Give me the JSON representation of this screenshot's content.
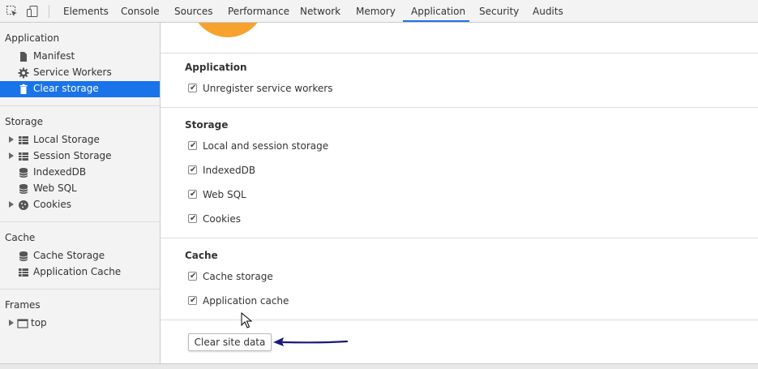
{
  "toolbar": {
    "tabs": [
      "Elements",
      "Console",
      "Sources",
      "Performance",
      "Network",
      "Memory",
      "Application",
      "Security",
      "Audits"
    ],
    "active_tab": "Application",
    "accent_color": "#1a73e8"
  },
  "sidebar": {
    "application": {
      "title": "Application",
      "items": [
        {
          "label": "Manifest",
          "icon": "file-icon"
        },
        {
          "label": "Service Workers",
          "icon": "gear-icon"
        },
        {
          "label": "Clear storage",
          "icon": "trash-icon",
          "selected": true
        }
      ]
    },
    "storage": {
      "title": "Storage",
      "items": [
        {
          "label": "Local Storage",
          "icon": "grid-icon",
          "expandable": true
        },
        {
          "label": "Session Storage",
          "icon": "grid-icon",
          "expandable": true
        },
        {
          "label": "IndexedDB",
          "icon": "database-icon"
        },
        {
          "label": "Web SQL",
          "icon": "database-icon"
        },
        {
          "label": "Cookies",
          "icon": "cookie-icon",
          "expandable": true
        }
      ]
    },
    "cache": {
      "title": "Cache",
      "items": [
        {
          "label": "Cache Storage",
          "icon": "database-icon"
        },
        {
          "label": "Application Cache",
          "icon": "grid-icon"
        }
      ]
    },
    "frames": {
      "title": "Frames",
      "items": [
        {
          "label": "top",
          "icon": "frame-icon",
          "expandable": true
        }
      ]
    }
  },
  "main": {
    "application_group": {
      "title": "Application",
      "options": [
        {
          "label": "Unregister service workers",
          "checked": true
        }
      ]
    },
    "storage_group": {
      "title": "Storage",
      "options": [
        {
          "label": "Local and session storage",
          "checked": true
        },
        {
          "label": "IndexedDB",
          "checked": true
        },
        {
          "label": "Web SQL",
          "checked": true
        },
        {
          "label": "Cookies",
          "checked": true
        }
      ]
    },
    "cache_group": {
      "title": "Cache",
      "options": [
        {
          "label": "Cache storage",
          "checked": true
        },
        {
          "label": "Application cache",
          "checked": true
        }
      ]
    },
    "clear_button_label": "Clear site data",
    "chart_color": "#f7a22f",
    "annotation_arrow_color": "#1a1a7a"
  }
}
